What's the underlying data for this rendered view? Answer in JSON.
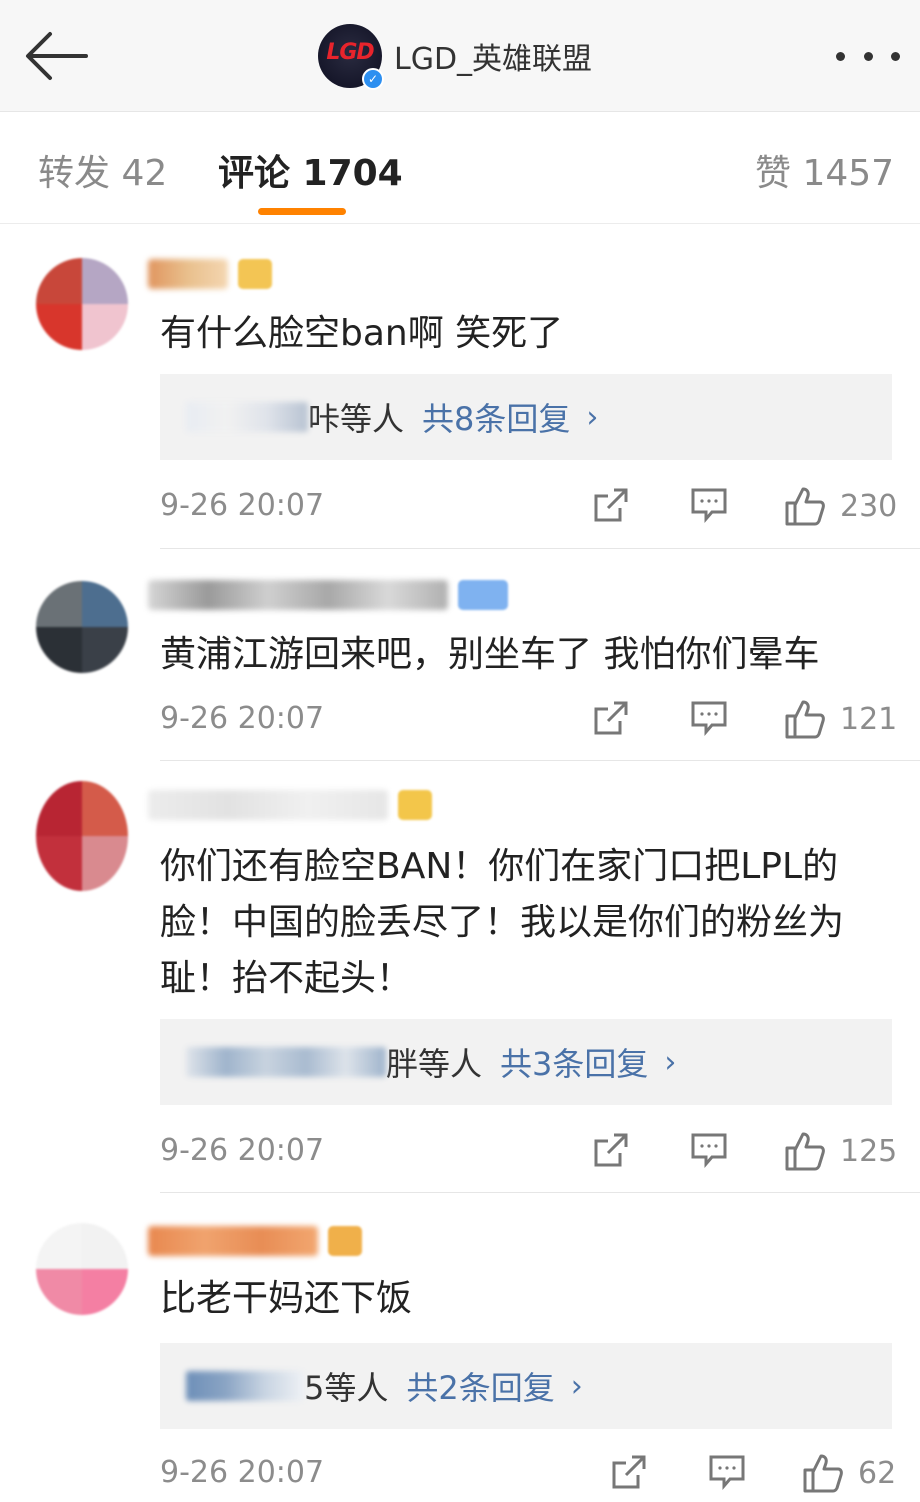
{
  "header": {
    "back_icon": "arrow-left-icon",
    "logo_text": "LGD",
    "profile_name": "LGD_英雄联盟",
    "more_icon": "more-dots-icon"
  },
  "tabs": {
    "repost_label": "转发 42",
    "comments_label": "评论 1704",
    "likes_label": "赞 1457",
    "accent_color": "#ff8200"
  },
  "comments": [
    {
      "text": "有什么脸空ban啊 笑死了",
      "reply_suffix": "咔等人",
      "reply_count": "共8条回复",
      "time": "9-26 20:07",
      "likes": "230"
    },
    {
      "text": "黄浦江游回来吧，别坐车了  我怕你们晕车",
      "time": "9-26 20:07",
      "likes": "121"
    },
    {
      "text": "你们还有脸空BAN！你们在家门口把LPL的脸！中国的脸丢尽了！我以是你们的粉丝为耻！抬不起头！",
      "reply_suffix": "胖等人",
      "reply_count": "共3条回复",
      "time": "9-26 20:07",
      "likes": "125"
    },
    {
      "text": "比老干妈还下饭",
      "reply_suffix": "5等人",
      "reply_count": "共2条回复",
      "time": "9-26 20:07",
      "likes": "62"
    }
  ],
  "icons": {
    "repost": "share-icon",
    "comment": "comment-icon",
    "like": "thumbs-up-icon",
    "chevron": "chevron-right-icon"
  },
  "colors": {
    "link_blue": "#4a72a8",
    "meta_gray": "#8c8c8c",
    "reply_bg": "#f2f2f2"
  }
}
